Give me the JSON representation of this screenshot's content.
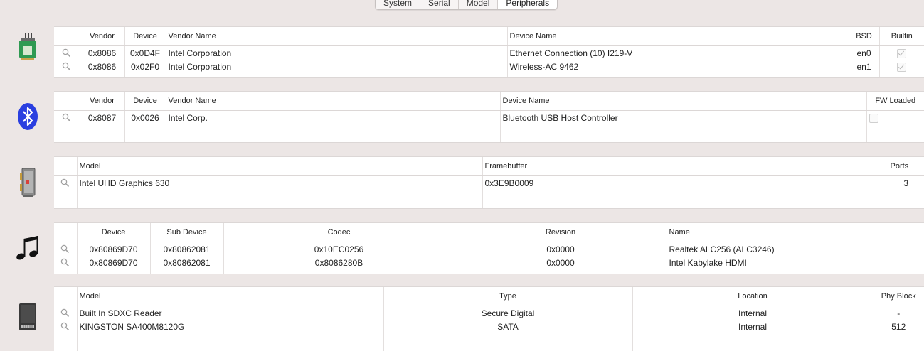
{
  "tabs": [
    "System",
    "Serial",
    "Model",
    "Peripherals"
  ],
  "active_tab": "Peripherals",
  "network": {
    "headers": [
      "Vendor",
      "Device",
      "Vendor Name",
      "Device Name",
      "BSD",
      "Builtin"
    ],
    "rows": [
      {
        "vendor": "0x8086",
        "device": "0x0D4F",
        "vendor_name": "Intel Corporation",
        "device_name": "Ethernet Connection (10) I219-V",
        "bsd": "en0",
        "builtin": true
      },
      {
        "vendor": "0x8086",
        "device": "0x02F0",
        "vendor_name": "Intel Corporation",
        "device_name": "Wireless-AC 9462",
        "bsd": "en1",
        "builtin": true
      }
    ]
  },
  "bluetooth": {
    "headers": [
      "Vendor",
      "Device",
      "Vendor Name",
      "Device Name",
      "FW Loaded"
    ],
    "rows": [
      {
        "vendor": "0x8087",
        "device": "0x0026",
        "vendor_name": "Intel Corp.",
        "device_name": "Bluetooth USB Host Controller",
        "fw_loaded": false
      }
    ]
  },
  "graphics": {
    "headers": [
      "Model",
      "Framebuffer",
      "Ports"
    ],
    "rows": [
      {
        "model": "Intel UHD Graphics 630",
        "framebuffer": "0x3E9B0009",
        "ports": "3"
      }
    ]
  },
  "audio": {
    "headers": [
      "Device",
      "Sub Device",
      "Codec",
      "Revision",
      "Name"
    ],
    "rows": [
      {
        "device": "0x80869D70",
        "sub_device": "0x80862081",
        "codec": "0x10EC0256",
        "revision": "0x0000",
        "name": "Realtek ALC256 (ALC3246)"
      },
      {
        "device": "0x80869D70",
        "sub_device": "0x80862081",
        "codec": "0x8086280B",
        "revision": "0x0000",
        "name": "Intel Kabylake HDMI"
      }
    ]
  },
  "storage": {
    "headers": [
      "Model",
      "Type",
      "Location",
      "Phy Block"
    ],
    "rows": [
      {
        "model": "Built In SDXC Reader",
        "type": "Secure Digital",
        "location": "Internal",
        "phy_block": "-"
      },
      {
        "model": "KINGSTON SA400M8120G",
        "type": "SATA",
        "location": "Internal",
        "phy_block": "512"
      }
    ]
  },
  "icons": {
    "network": "network-card-icon",
    "bluetooth": "bluetooth-icon",
    "graphics": "graphics-card-icon",
    "audio": "music-note-icon",
    "storage": "storage-drive-icon",
    "row": "magnifier-icon"
  },
  "colors": {
    "background": "#ece6e5",
    "panel": "#ffffff",
    "bluetooth": "#2a3fe0"
  }
}
